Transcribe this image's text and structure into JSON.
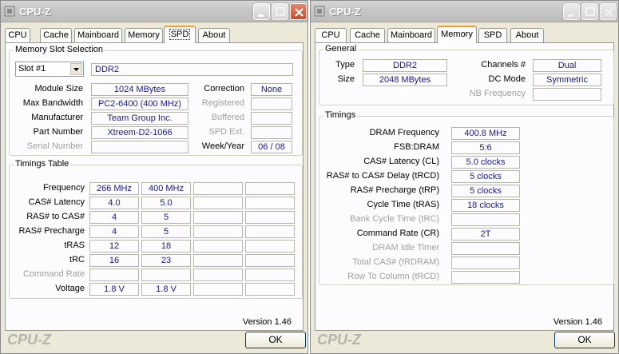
{
  "left": {
    "title": "CPU-Z",
    "tabs": [
      "CPU",
      "Cache",
      "Mainboard",
      "Memory",
      "SPD",
      "About"
    ],
    "slot_section": {
      "title": "Memory Slot Selection",
      "slot_value": "Slot #1",
      "mem_type": "DDR2",
      "module_size_label": "Module Size",
      "module_size": "1024 MBytes",
      "max_bandwidth_label": "Max Bandwidth",
      "max_bandwidth": "PC2-6400 (400 MHz)",
      "manufacturer_label": "Manufacturer",
      "manufacturer": "Team Group Inc.",
      "part_number_label": "Part Number",
      "part_number": "Xtreem-D2-1066",
      "serial_number_label": "Serial Number",
      "serial_number": "",
      "correction_label": "Correction",
      "correction": "None",
      "registered_label": "Registered",
      "registered": "",
      "buffered_label": "Buffered",
      "buffered": "",
      "spd_ext_label": "SPD Ext.",
      "spd_ext": "",
      "week_year_label": "Week/Year",
      "week_year": "06 / 08"
    },
    "timings_table": {
      "title": "Timings Table",
      "rows": [
        {
          "label": "Frequency",
          "values": [
            "266 MHz",
            "400 MHz",
            "",
            ""
          ],
          "gray": false
        },
        {
          "label": "CAS# Latency",
          "values": [
            "4.0",
            "5.0",
            "",
            ""
          ],
          "gray": false
        },
        {
          "label": "RAS# to CAS#",
          "values": [
            "4",
            "5",
            "",
            ""
          ],
          "gray": false
        },
        {
          "label": "RAS# Precharge",
          "values": [
            "4",
            "5",
            "",
            ""
          ],
          "gray": false
        },
        {
          "label": "tRAS",
          "values": [
            "12",
            "18",
            "",
            ""
          ],
          "gray": false
        },
        {
          "label": "tRC",
          "values": [
            "16",
            "23",
            "",
            ""
          ],
          "gray": false
        },
        {
          "label": "Command Rate",
          "values": [
            "",
            "",
            "",
            ""
          ],
          "gray": true
        },
        {
          "label": "Voltage",
          "values": [
            "1.8 V",
            "1.8 V",
            "",
            ""
          ],
          "gray": false
        }
      ]
    },
    "version": "Version 1.46",
    "brand": "CPU-Z",
    "ok_label": "OK"
  },
  "right": {
    "title": "CPU-Z",
    "tabs": [
      "CPU",
      "Cache",
      "Mainboard",
      "Memory",
      "SPD",
      "About"
    ],
    "general": {
      "title": "General",
      "type_label": "Type",
      "type": "DDR2",
      "size_label": "Size",
      "size": "2048 MBytes",
      "channels_label": "Channels #",
      "channels": "Dual",
      "dc_mode_label": "DC Mode",
      "dc_mode": "Symmetric",
      "nb_freq_label": "NB Frequency",
      "nb_freq": ""
    },
    "timings": {
      "title": "Timings",
      "rows": [
        {
          "label": "DRAM Frequency",
          "value": "400.8 MHz",
          "gray": false
        },
        {
          "label": "FSB:DRAM",
          "value": "5:6",
          "gray": false
        },
        {
          "label": "CAS# Latency (CL)",
          "value": "5.0 clocks",
          "gray": false
        },
        {
          "label": "RAS# to CAS# Delay (tRCD)",
          "value": "5 clocks",
          "gray": false
        },
        {
          "label": "RAS# Precharge (tRP)",
          "value": "5 clocks",
          "gray": false
        },
        {
          "label": "Cycle Time (tRAS)",
          "value": "18 clocks",
          "gray": false
        },
        {
          "label": "Bank Cycle Time (tRC)",
          "value": "",
          "gray": true
        },
        {
          "label": "Command Rate (CR)",
          "value": "2T",
          "gray": false
        },
        {
          "label": "DRAM Idle Timer",
          "value": "",
          "gray": true
        },
        {
          "label": "Total CAS# (tRDRAM)",
          "value": "",
          "gray": true
        },
        {
          "label": "Row To Column (tRCD)",
          "value": "",
          "gray": true
        }
      ]
    },
    "version": "Version 1.46",
    "brand": "CPU-Z",
    "ok_label": "OK"
  },
  "colors": {
    "value_text": "#1a1a8c",
    "active_tab_accent": "#f0a030",
    "gray_label": "#a0a0a0"
  }
}
